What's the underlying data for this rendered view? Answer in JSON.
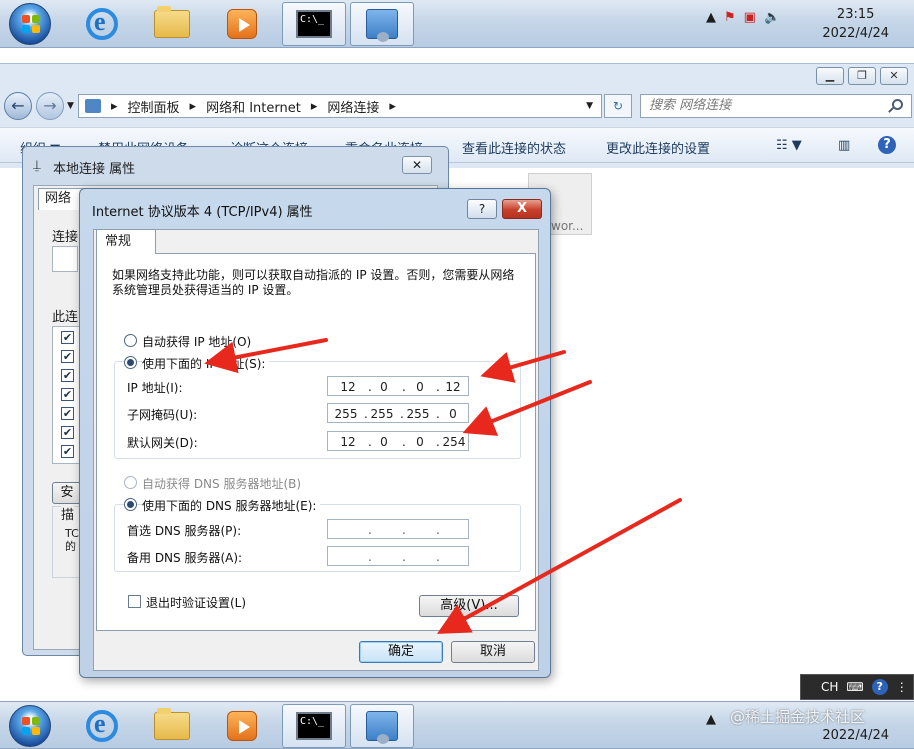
{
  "top_taskbar": {
    "cmd_text": "C:\\_",
    "clock_time": "23:15",
    "clock_date": "2022/4/24"
  },
  "explorer": {
    "breadcrumb": [
      "控制面板",
      "网络和 Internet",
      "网络连接"
    ],
    "search_placeholder": "搜索 网络连接",
    "commands": [
      "组织 ▼",
      "禁用此网络设备",
      "诊断这个连接",
      "重命名此连接",
      "查看此连接的状态",
      "更改此连接的设置"
    ],
    "tile_text": "wor..."
  },
  "back_dialog": {
    "title": "本地连接 属性",
    "tab": "网络",
    "connect_label": "连接",
    "this_conn_label": "此连",
    "desc_label": "描",
    "desc_text": "TC\n的",
    "button_partial": "安"
  },
  "dialog": {
    "title": "Internet 协议版本 4 (TCP/IPv4) 属性",
    "help": "?",
    "close": "X",
    "tab": "常规",
    "intro": "如果网络支持此功能，则可以获取自动指派的 IP 设置。否则，您需要从网络系统管理员处获得适当的 IP 设置。",
    "auto_ip": "自动获得 IP 地址(O)",
    "manual_ip": "使用下面的 IP 地址(S):",
    "ip_label": "IP 地址(I):",
    "subnet_label": "子网掩码(U):",
    "gateway_label": "默认网关(D):",
    "ip": [
      "12",
      "0",
      "0",
      "12"
    ],
    "subnet": [
      "255",
      "255",
      "255",
      "0"
    ],
    "gateway": [
      "12",
      "0",
      "0",
      "254"
    ],
    "auto_dns": "自动获得 DNS 服务器地址(B)",
    "manual_dns": "使用下面的 DNS 服务器地址(E):",
    "preferred_dns_label": "首选 DNS 服务器(P):",
    "alternate_dns_label": "备用 DNS 服务器(A):",
    "validate_on_exit": "退出时验证设置(L)",
    "advanced": "高级(V)...",
    "ok": "确定",
    "cancel": "取消"
  },
  "ime": {
    "lang": "CH"
  },
  "bottom_taskbar": {
    "cmd_text": "C:\\_",
    "clock_date": "2022/4/24"
  },
  "watermark": "@稀土掘金技术社区",
  "colors": {
    "arrow": "#e8281c",
    "selection_accent": "#3b78b8"
  }
}
